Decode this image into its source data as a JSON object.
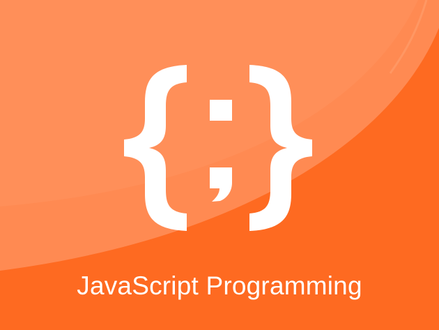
{
  "colors": {
    "background": "#fe6a21",
    "overlay_light": "#ff8a52",
    "overlay_lighter": "#ff9462",
    "foreground": "#ffffff"
  },
  "logo": {
    "icon": "curly-braces-semicolon-icon"
  },
  "title": "JavaScript Programming"
}
